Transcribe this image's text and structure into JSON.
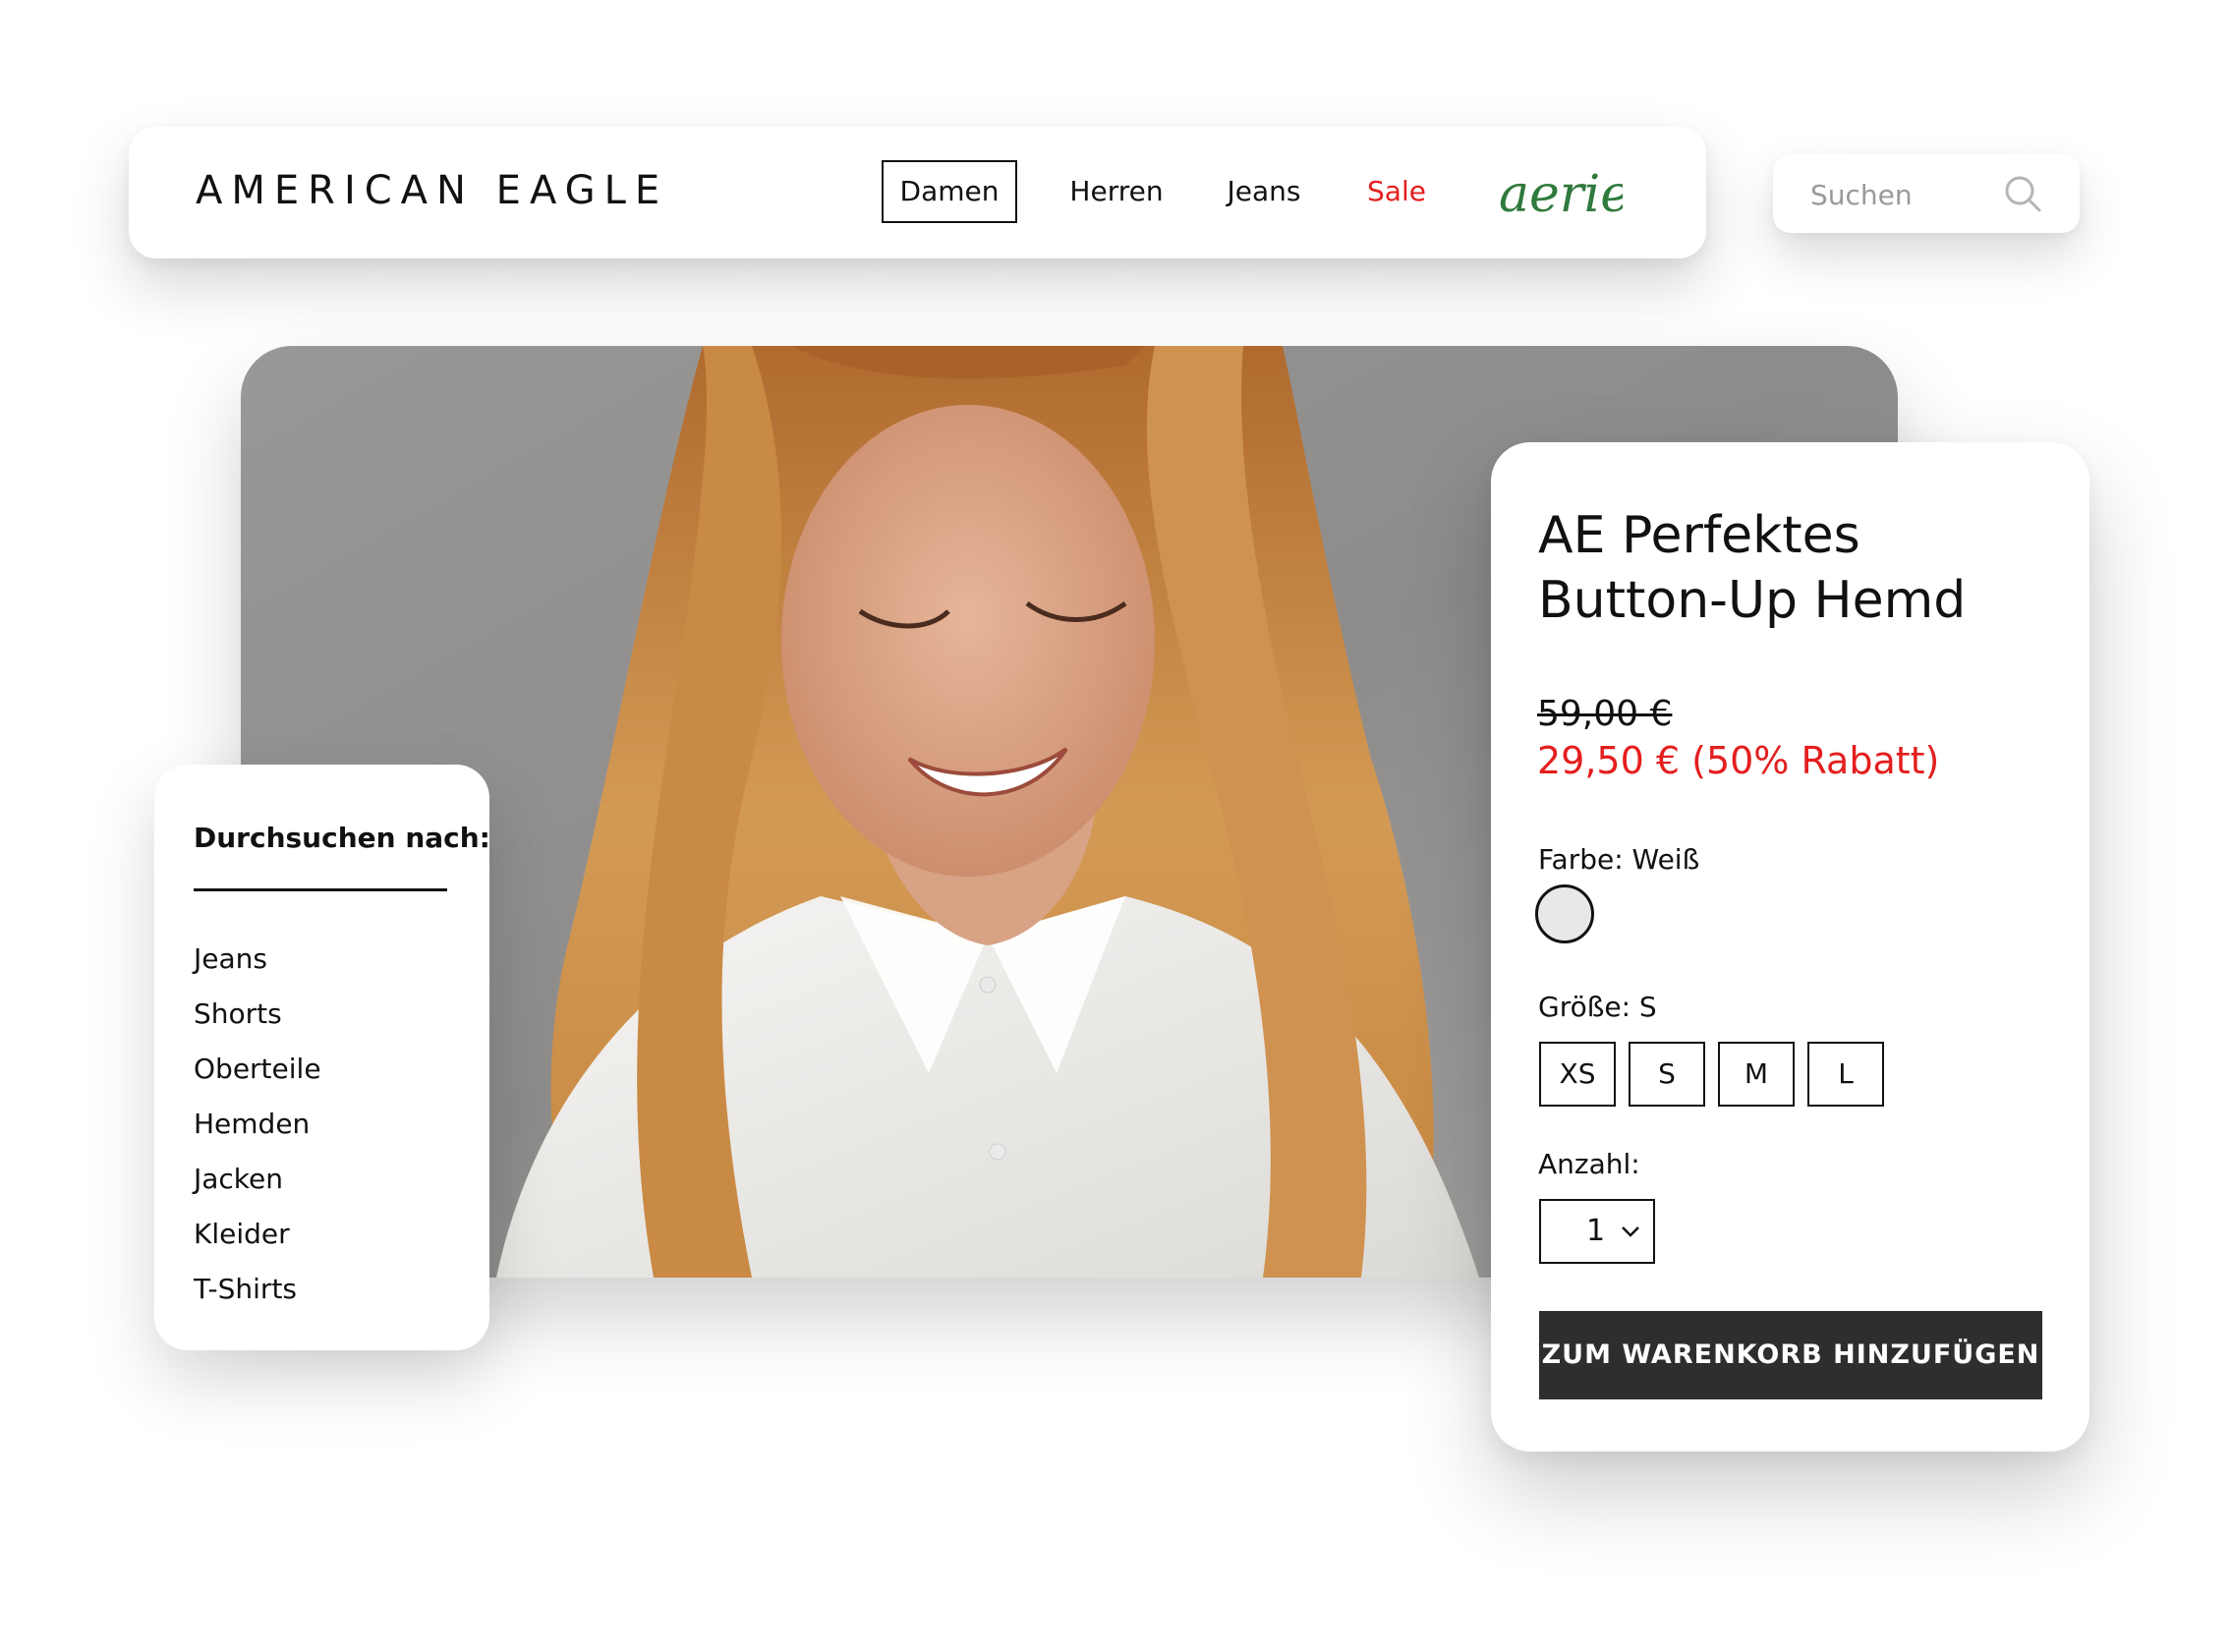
{
  "header": {
    "logo": "AMERICAN EAGLE",
    "nav": [
      {
        "label": "Damen",
        "active": true
      },
      {
        "label": "Herren"
      },
      {
        "label": "Jeans"
      },
      {
        "label": "Sale",
        "color": "#e41e1e"
      }
    ],
    "brand_logo": "aerie",
    "brand_logo_color": "#2f7a3c"
  },
  "search": {
    "placeholder": "Suchen",
    "icon": "search-icon"
  },
  "sidebar": {
    "title": "Durchsuchen nach:",
    "items": [
      "Jeans",
      "Shorts",
      "Oberteile",
      "Hemden",
      "Jacken",
      "Kleider",
      "T-Shirts"
    ]
  },
  "product": {
    "title_line1": "AE Perfektes",
    "title_line2": "Button-Up Hemd",
    "price_old": "59,00 €",
    "price_new": "29,50 € (50% Rabatt)",
    "price_new_color": "#e41e1e",
    "color_label": "Farbe: Weiß",
    "swatch_color": "#e8e8e8",
    "size_label": "Größe: S",
    "sizes": [
      "XS",
      "S",
      "M",
      "L"
    ],
    "quantity_label": "Anzahl:",
    "quantity_value": "1",
    "add_to_cart": "ZUM WARENKORB HINZUFÜGEN"
  }
}
